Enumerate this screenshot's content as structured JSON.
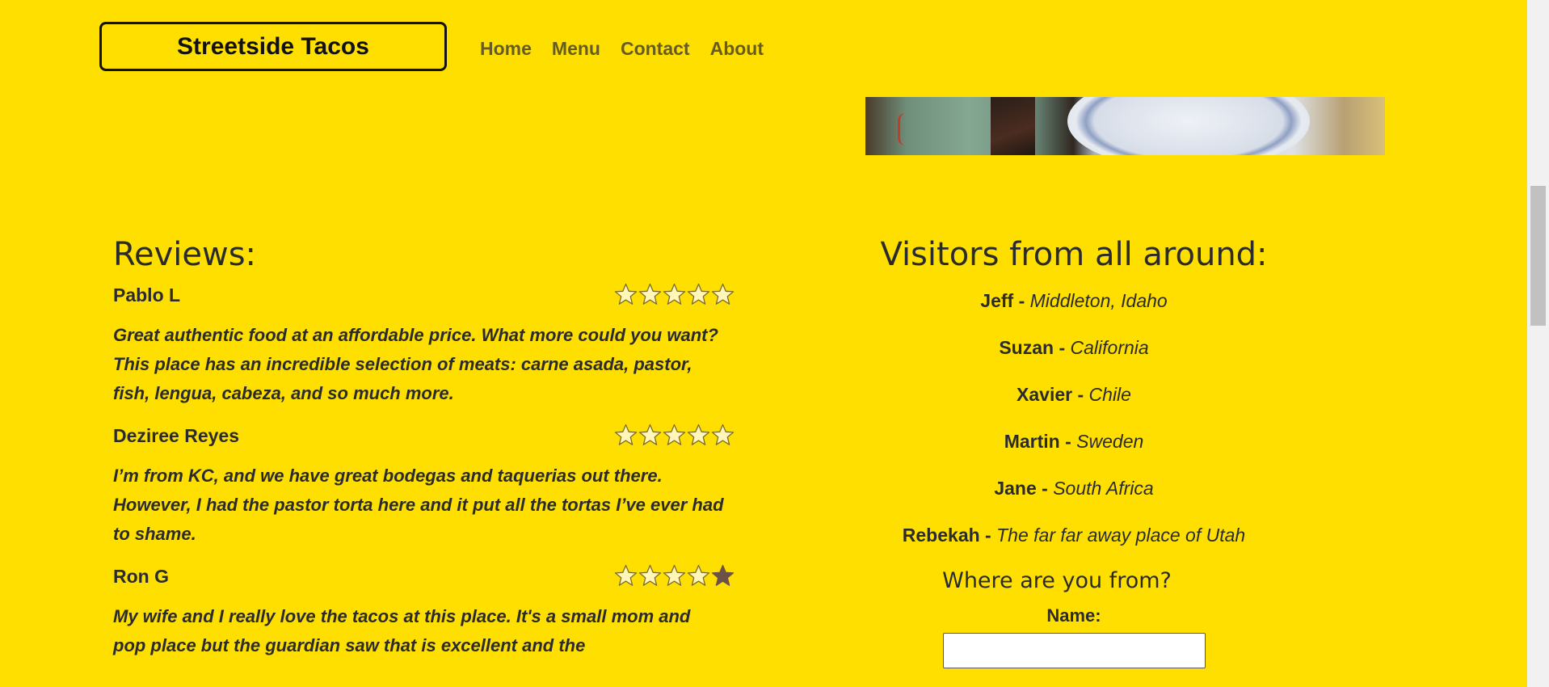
{
  "header": {
    "logo": "Streetside Tacos",
    "nav": [
      "Home",
      "Menu",
      "Contact",
      "About"
    ]
  },
  "reviews": {
    "title": "Reviews:",
    "items": [
      {
        "name": "Pablo L",
        "rating": 0,
        "text": "Great authentic food at an affordable price. What more could you want? This place has an incredible selection of meats: carne asada, pastor, fish, lengua, cabeza, and so much more."
      },
      {
        "name": "Deziree Reyes",
        "rating": 0,
        "text": "I’m from KC, and we have great bodegas and taquerias out there. However, I had the pastor torta here and it put all the tortas I’ve ever had to shame."
      },
      {
        "name": "Ron G",
        "rating": 1,
        "text": "My wife and I really love the tacos at this place. It's a small mom and pop place but the guardian saw that is excellent and the"
      }
    ]
  },
  "visitors": {
    "title": "Visitors from all around:",
    "items": [
      {
        "name": "Jeff",
        "place": "Middleton, Idaho"
      },
      {
        "name": "Suzan",
        "place": "California"
      },
      {
        "name": "Xavier",
        "place": "Chile"
      },
      {
        "name": "Martin",
        "place": "Sweden"
      },
      {
        "name": "Jane",
        "place": "South Africa"
      },
      {
        "name": "Rebekah",
        "place": "The far far away place of Utah"
      }
    ],
    "separator": "-",
    "form_title": "Where are you from?",
    "name_label": "Name:",
    "name_value": ""
  },
  "colors": {
    "background": "#FEDF00",
    "nav_text": "#665c22",
    "star_empty_fill": "#FEDF00",
    "star_filled": "#6b5148"
  }
}
